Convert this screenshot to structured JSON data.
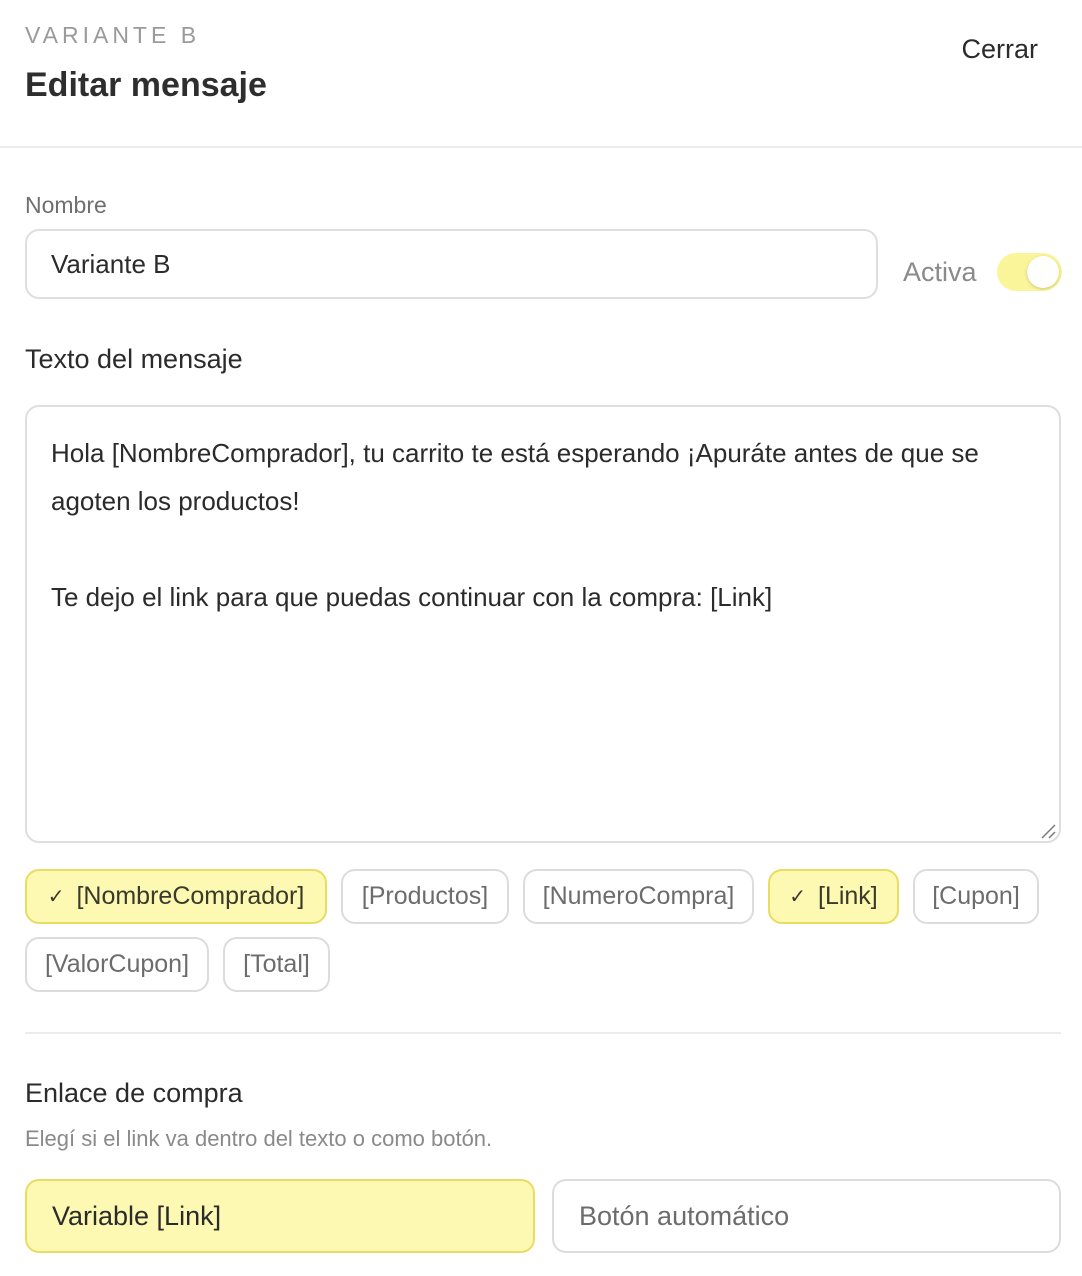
{
  "header": {
    "eyebrow": "VARIANTE B",
    "title": "Editar mensaje",
    "close_label": "Cerrar"
  },
  "name_field": {
    "label": "Nombre",
    "value": "Variante B"
  },
  "active_toggle": {
    "label": "Activa",
    "checked": true
  },
  "message": {
    "label": "Texto del mensaje",
    "value": "Hola [NombreComprador], tu carrito te está esperando ¡Apuráte antes de que se agoten los productos!\n\nTe dejo el link para que puedas continuar con la compra: [Link]"
  },
  "variables": [
    {
      "label": "[NombreComprador]",
      "selected": true
    },
    {
      "label": "[Productos]",
      "selected": false
    },
    {
      "label": "[NumeroCompra]",
      "selected": false
    },
    {
      "label": "[Link]",
      "selected": true
    },
    {
      "label": "[Cupon]",
      "selected": false
    },
    {
      "label": "[ValorCupon]",
      "selected": false
    },
    {
      "label": "[Total]",
      "selected": false
    }
  ],
  "purchase_link": {
    "title": "Enlace de compra",
    "subtitle": "Elegí si el link va dentro del texto o como botón.",
    "options": [
      {
        "label": "Variable [Link]",
        "selected": true
      },
      {
        "label": "Botón automático",
        "selected": false
      }
    ]
  },
  "colors": {
    "accent_bg": "#fdf8b2",
    "accent_border": "#e9dc62",
    "toggle_on": "#fbf59a"
  }
}
